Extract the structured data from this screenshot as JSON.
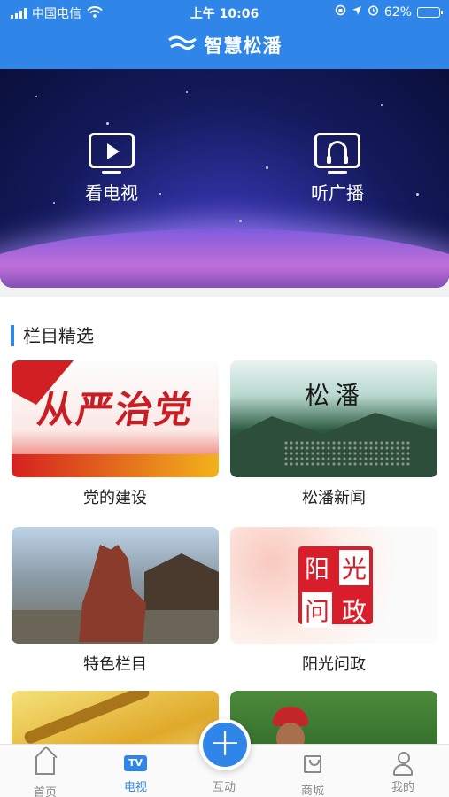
{
  "status_bar": {
    "carrier": "中国电信",
    "time": "上午 10:06",
    "battery": "62%",
    "battery_level": 0.62
  },
  "header": {
    "title": "智慧松潘"
  },
  "banner": {
    "items": [
      {
        "label": "看电视",
        "icon": "tv-play-icon"
      },
      {
        "label": "听广播",
        "icon": "radio-headphone-icon"
      }
    ]
  },
  "section": {
    "title": "栏目精选",
    "cards": [
      {
        "caption": "党的建设",
        "image_text": "从严治党"
      },
      {
        "caption": "松潘新闻",
        "image_text": "松潘"
      },
      {
        "caption": "特色栏目"
      },
      {
        "caption": "阳光问政",
        "seal": [
          "阳",
          "光",
          "问",
          "政"
        ]
      }
    ]
  },
  "tabbar": {
    "items": [
      {
        "label": "首页",
        "icon": "home-icon"
      },
      {
        "label": "电视",
        "icon": "tv-icon",
        "badge": "TV"
      },
      {
        "label": "互动",
        "icon": "plus-icon"
      },
      {
        "label": "商城",
        "icon": "shopping-bag-icon"
      },
      {
        "label": "我的",
        "icon": "user-icon"
      }
    ],
    "active": "电视"
  },
  "colors": {
    "primary": "#2f86e8",
    "banner_dark": "#0a0f3a",
    "inactive": "#8a8a8a"
  }
}
